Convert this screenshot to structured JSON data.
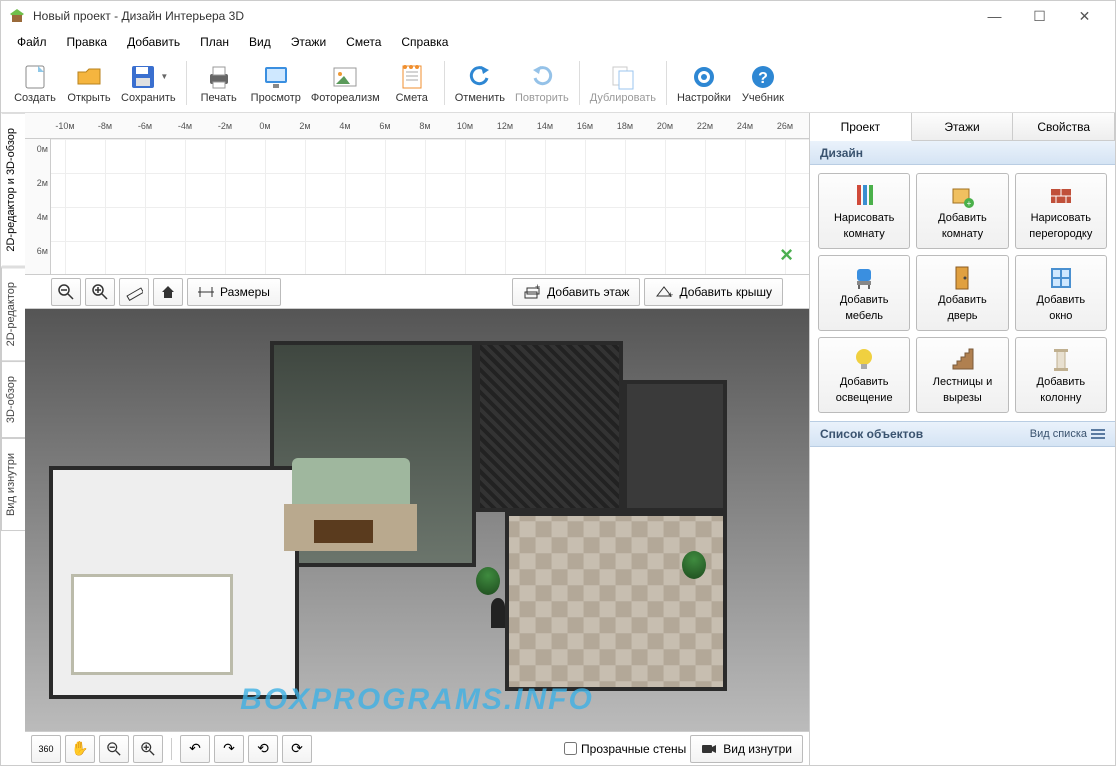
{
  "window": {
    "title": "Новый проект - Дизайн Интерьера 3D"
  },
  "menubar": [
    "Файл",
    "Правка",
    "Добавить",
    "План",
    "Вид",
    "Этажи",
    "Смета",
    "Справка"
  ],
  "toolbar": [
    {
      "id": "create",
      "label": "Создать",
      "icon": "doc",
      "color": "#8fc8e8"
    },
    {
      "id": "open",
      "label": "Открыть",
      "icon": "folder",
      "color": "#f5b53f"
    },
    {
      "id": "save",
      "label": "Сохранить",
      "icon": "floppy",
      "color": "#3a6fcf",
      "dropdown": true
    },
    {
      "sep": true
    },
    {
      "id": "print",
      "label": "Печать",
      "icon": "printer",
      "color": "#666"
    },
    {
      "id": "preview",
      "label": "Просмотр",
      "icon": "monitor",
      "color": "#3a8fe0"
    },
    {
      "id": "photorealism",
      "label": "Фотореализм",
      "icon": "picture",
      "color": "#ef9934"
    },
    {
      "id": "estimate",
      "label": "Смета",
      "icon": "notepad",
      "color": "#f08f2f"
    },
    {
      "sep": true
    },
    {
      "id": "undo",
      "label": "Отменить",
      "icon": "undo",
      "color": "#2e87d3"
    },
    {
      "id": "redo",
      "label": "Повторить",
      "icon": "redo",
      "color": "#2e87d3",
      "disabled": true
    },
    {
      "sep": true
    },
    {
      "id": "duplicate",
      "label": "Дублировать",
      "icon": "copy",
      "color": "#3a8fe0",
      "disabled": true
    },
    {
      "sep": true
    },
    {
      "id": "settings",
      "label": "Настройки",
      "icon": "gear",
      "color": "#2e87d3"
    },
    {
      "id": "help",
      "label": "Учебник",
      "icon": "help",
      "color": "#2e87d3"
    }
  ],
  "left_tabs": [
    {
      "id": "2d3d",
      "label": "2D-редактор и 3D-обзор",
      "active": true
    },
    {
      "id": "2d",
      "label": "2D-редактор"
    },
    {
      "id": "3d",
      "label": "3D-обзор"
    },
    {
      "id": "inside",
      "label": "Вид изнутри"
    }
  ],
  "ruler_h": [
    "-10м",
    "-8м",
    "-6м",
    "-4м",
    "-2м",
    "0м",
    "2м",
    "4м",
    "6м",
    "8м",
    "10м",
    "12м",
    "14м",
    "16м",
    "18м",
    "20м",
    "22м",
    "24м",
    "26м"
  ],
  "ruler_v": [
    "0м",
    "2м",
    "4м",
    "6м"
  ],
  "canvas_toolbar": {
    "sizes_label": "Размеры",
    "add_floor": "Добавить этаж",
    "add_roof": "Добавить крышу"
  },
  "bottom_toolbar": {
    "transparent_walls": "Прозрачные стены",
    "view_inside": "Вид изнутри"
  },
  "watermark": "BOXPROGRAMS.INFO",
  "right_panel": {
    "tabs": [
      {
        "id": "project",
        "label": "Проект",
        "active": true
      },
      {
        "id": "floors",
        "label": "Этажи"
      },
      {
        "id": "props",
        "label": "Свойства"
      }
    ],
    "design_header": "Дизайн",
    "palette": [
      {
        "id": "draw-room",
        "l1": "Нарисовать",
        "l2": "комнату",
        "icon": "pencils",
        "c": "#e07030"
      },
      {
        "id": "add-room",
        "l1": "Добавить",
        "l2": "комнату",
        "icon": "addroom",
        "c": "#f0a030"
      },
      {
        "id": "draw-partition",
        "l1": "Нарисовать",
        "l2": "перегородку",
        "icon": "bricks",
        "c": "#c0503a"
      },
      {
        "id": "add-furniture",
        "l1": "Добавить",
        "l2": "мебель",
        "icon": "chair",
        "c": "#3a8fe0"
      },
      {
        "id": "add-door",
        "l1": "Добавить",
        "l2": "дверь",
        "icon": "door",
        "c": "#e0a040"
      },
      {
        "id": "add-window",
        "l1": "Добавить",
        "l2": "окно",
        "icon": "window",
        "c": "#4a90d0"
      },
      {
        "id": "add-light",
        "l1": "Добавить",
        "l2": "освещение",
        "icon": "bulb",
        "c": "#f0d040"
      },
      {
        "id": "stairs",
        "l1": "Лестницы и",
        "l2": "вырезы",
        "icon": "stairs",
        "c": "#b08050"
      },
      {
        "id": "add-column",
        "l1": "Добавить",
        "l2": "колонну",
        "icon": "column",
        "c": "#c0b090"
      }
    ],
    "objects_header": "Список объектов",
    "view_list": "Вид списка"
  }
}
